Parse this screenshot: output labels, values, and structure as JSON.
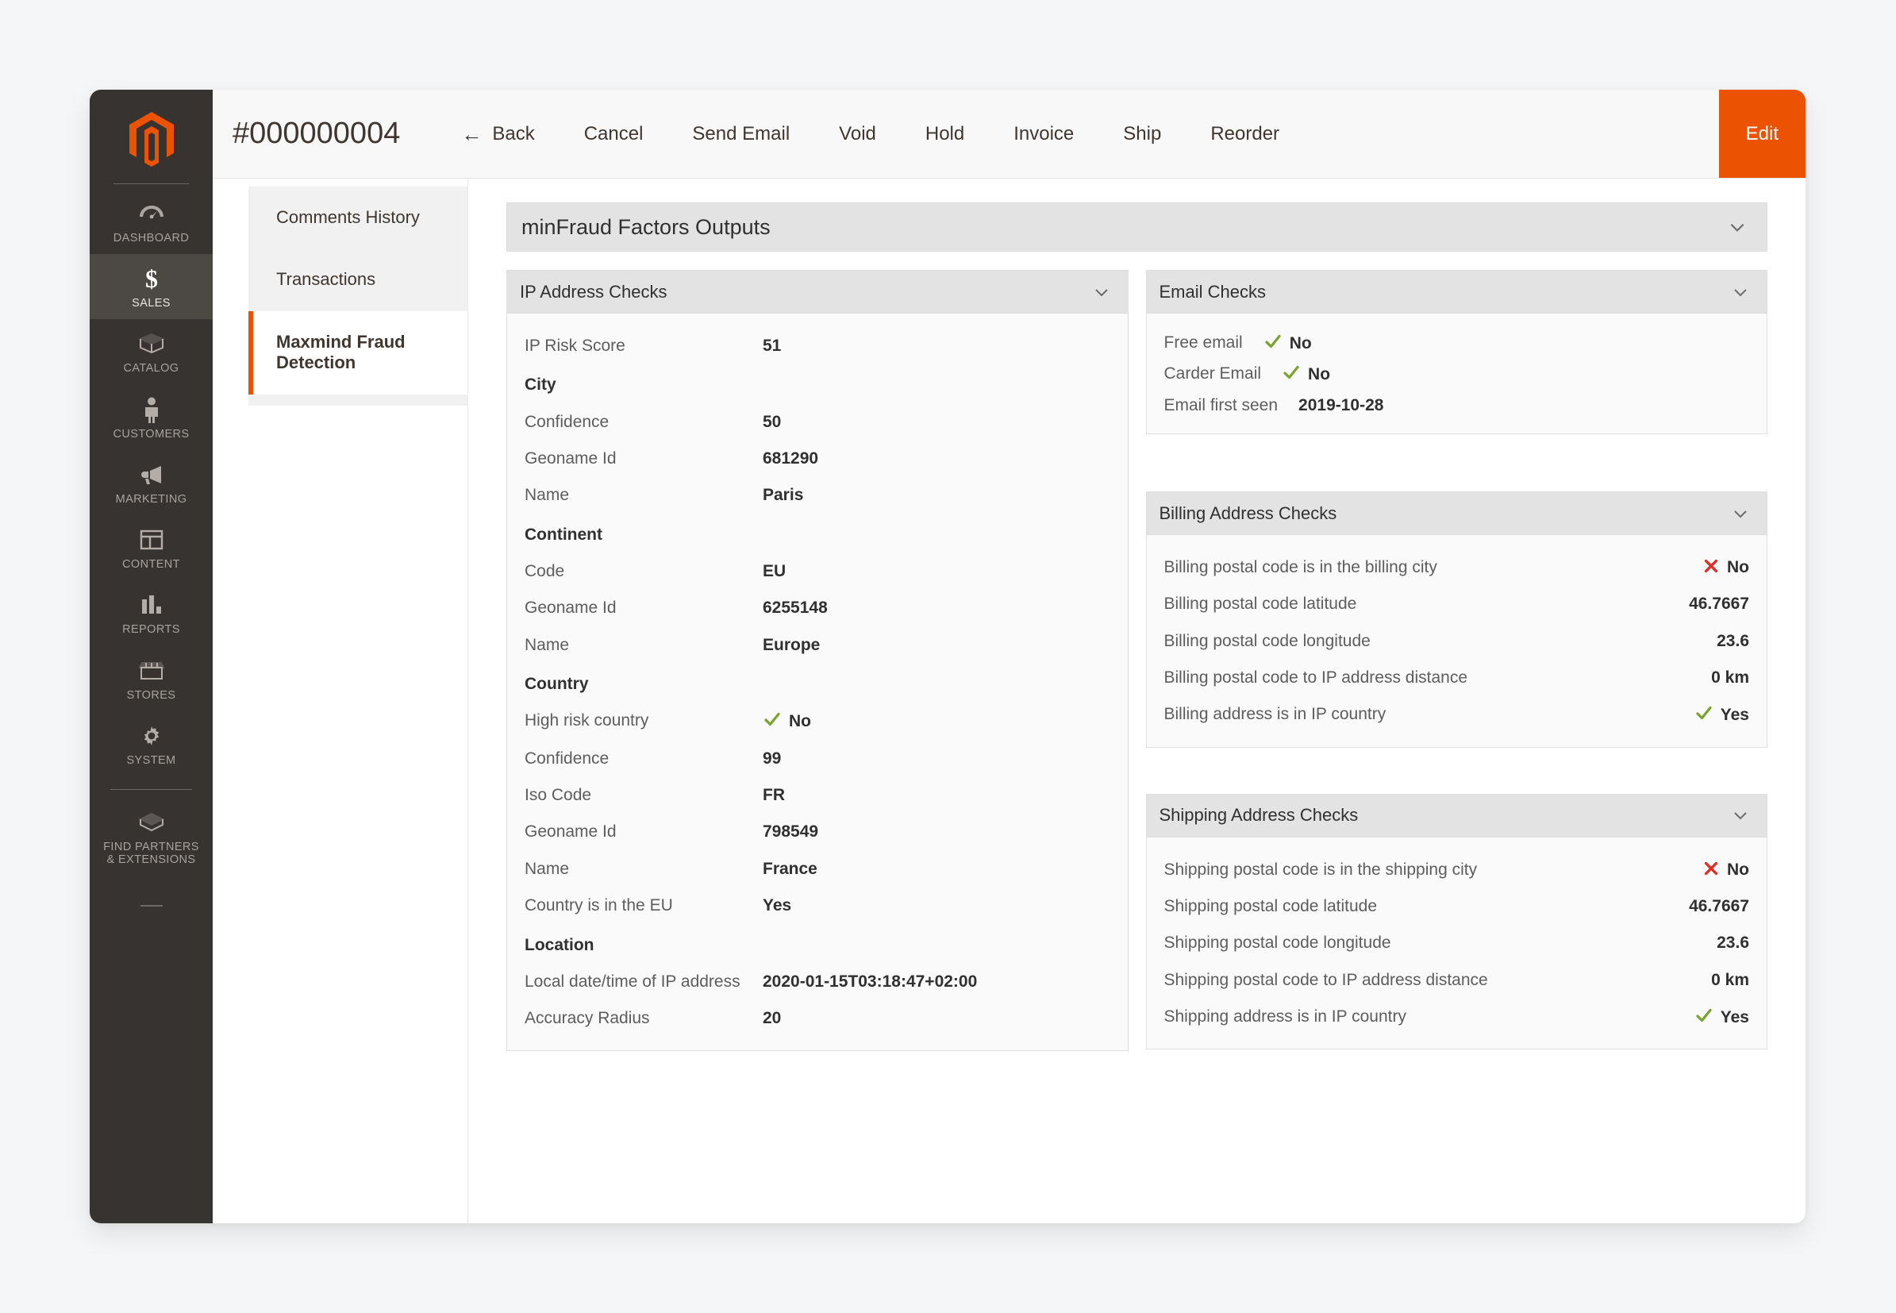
{
  "header": {
    "order_id": "#000000004",
    "back_label": "Back",
    "back_icon": "arrow-left-icon",
    "actions": [
      "Cancel",
      "Send Email",
      "Void",
      "Hold",
      "Invoice",
      "Ship",
      "Reorder"
    ],
    "edit_label": "Edit",
    "edit_color": "#eb5202"
  },
  "rail": {
    "logo_icon": "magento-logo-icon",
    "items": [
      {
        "label": "DASHBOARD",
        "icon": "dashboard-icon",
        "active": false
      },
      {
        "label": "SALES",
        "icon": "dollar-icon",
        "active": true
      },
      {
        "label": "CATALOG",
        "icon": "box-icon",
        "active": false
      },
      {
        "label": "CUSTOMERS",
        "icon": "person-icon",
        "active": false
      },
      {
        "label": "MARKETING",
        "icon": "megaphone-icon",
        "active": false
      },
      {
        "label": "CONTENT",
        "icon": "layout-icon",
        "active": false
      },
      {
        "label": "REPORTS",
        "icon": "bar-chart-icon",
        "active": false
      },
      {
        "label": "STORES",
        "icon": "storefront-icon",
        "active": false
      },
      {
        "label": "SYSTEM",
        "icon": "gear-icon",
        "active": false
      },
      {
        "label": "FIND PARTNERS\n& EXTENSIONS",
        "icon": "package-icon",
        "active": false
      }
    ]
  },
  "subnav": {
    "items": [
      {
        "label": "Comments History",
        "active": false
      },
      {
        "label": "Transactions",
        "active": false
      },
      {
        "label": "Maxmind Fraud Detection",
        "active": true
      }
    ]
  },
  "section": {
    "title": "minFraud Factors Outputs",
    "chevron_icon": "chevron-down-icon"
  },
  "ip_panel": {
    "title": "IP Address Checks",
    "chevron_icon": "chevron-down-icon",
    "rows": [
      {
        "type": "kv",
        "label": "IP Risk Score",
        "value": "51"
      },
      {
        "type": "group",
        "label": "City"
      },
      {
        "type": "kv",
        "label": "Confidence",
        "value": "50"
      },
      {
        "type": "kv",
        "label": "Geoname Id",
        "value": "681290"
      },
      {
        "type": "kv",
        "label": "Name",
        "value": "Paris"
      },
      {
        "type": "group",
        "label": "Continent"
      },
      {
        "type": "kv",
        "label": "Code",
        "value": "EU"
      },
      {
        "type": "kv",
        "label": "Geoname Id",
        "value": "6255148"
      },
      {
        "type": "kv",
        "label": "Name",
        "value": "Europe"
      },
      {
        "type": "group",
        "label": "Country"
      },
      {
        "type": "kv",
        "label": "High risk country",
        "value": "No",
        "mark": "yes"
      },
      {
        "type": "kv",
        "label": "Confidence",
        "value": "99"
      },
      {
        "type": "kv",
        "label": "Iso Code",
        "value": "FR"
      },
      {
        "type": "kv",
        "label": "Geoname Id",
        "value": "798549"
      },
      {
        "type": "kv",
        "label": "Name",
        "value": "France"
      },
      {
        "type": "kv",
        "label": "Country is in the EU",
        "value": "Yes"
      },
      {
        "type": "group",
        "label": "Location"
      },
      {
        "type": "kv",
        "label": "Local date/time of IP address",
        "value": "2020-01-15T03:18:47+02:00"
      },
      {
        "type": "kv",
        "label": "Accuracy Radius",
        "value": "20"
      }
    ]
  },
  "email_panel": {
    "title": "Email Checks",
    "chevron_icon": "chevron-down-icon",
    "rows": [
      {
        "label": "Free email",
        "value": "No",
        "mark": "yes"
      },
      {
        "label": "Carder Email",
        "value": "No",
        "mark": "yes"
      },
      {
        "label": "Email first seen",
        "value": "2019-10-28"
      }
    ]
  },
  "billing_panel": {
    "title": "Billing Address Checks",
    "chevron_icon": "chevron-down-icon",
    "rows": [
      {
        "label": "Billing postal code is in the billing city",
        "value": "No",
        "mark": "no"
      },
      {
        "label": "Billing postal code latitude",
        "value": "46.7667"
      },
      {
        "label": "Billing postal code longitude",
        "value": "23.6"
      },
      {
        "label": "Billing postal code to IP address distance",
        "value": "0 km"
      },
      {
        "label": "Billing address is in IP country",
        "value": "Yes",
        "mark": "yes"
      }
    ]
  },
  "shipping_panel": {
    "title": "Shipping Address Checks",
    "chevron_icon": "chevron-down-icon",
    "rows": [
      {
        "label": "Shipping postal code is in the shipping city",
        "value": "No",
        "mark": "no"
      },
      {
        "label": "Shipping postal code latitude",
        "value": "46.7667"
      },
      {
        "label": "Shipping postal code longitude",
        "value": "23.6"
      },
      {
        "label": "Shipping postal code to IP address distance",
        "value": "0 km"
      },
      {
        "label": "Shipping address is in IP country",
        "value": "Yes",
        "mark": "yes"
      }
    ]
  },
  "colors": {
    "accent": "#eb5202",
    "rail_bg": "#373330",
    "panel_header": "#e3e3e3",
    "yes_green": "#79a22e",
    "no_red": "#e02b27"
  }
}
